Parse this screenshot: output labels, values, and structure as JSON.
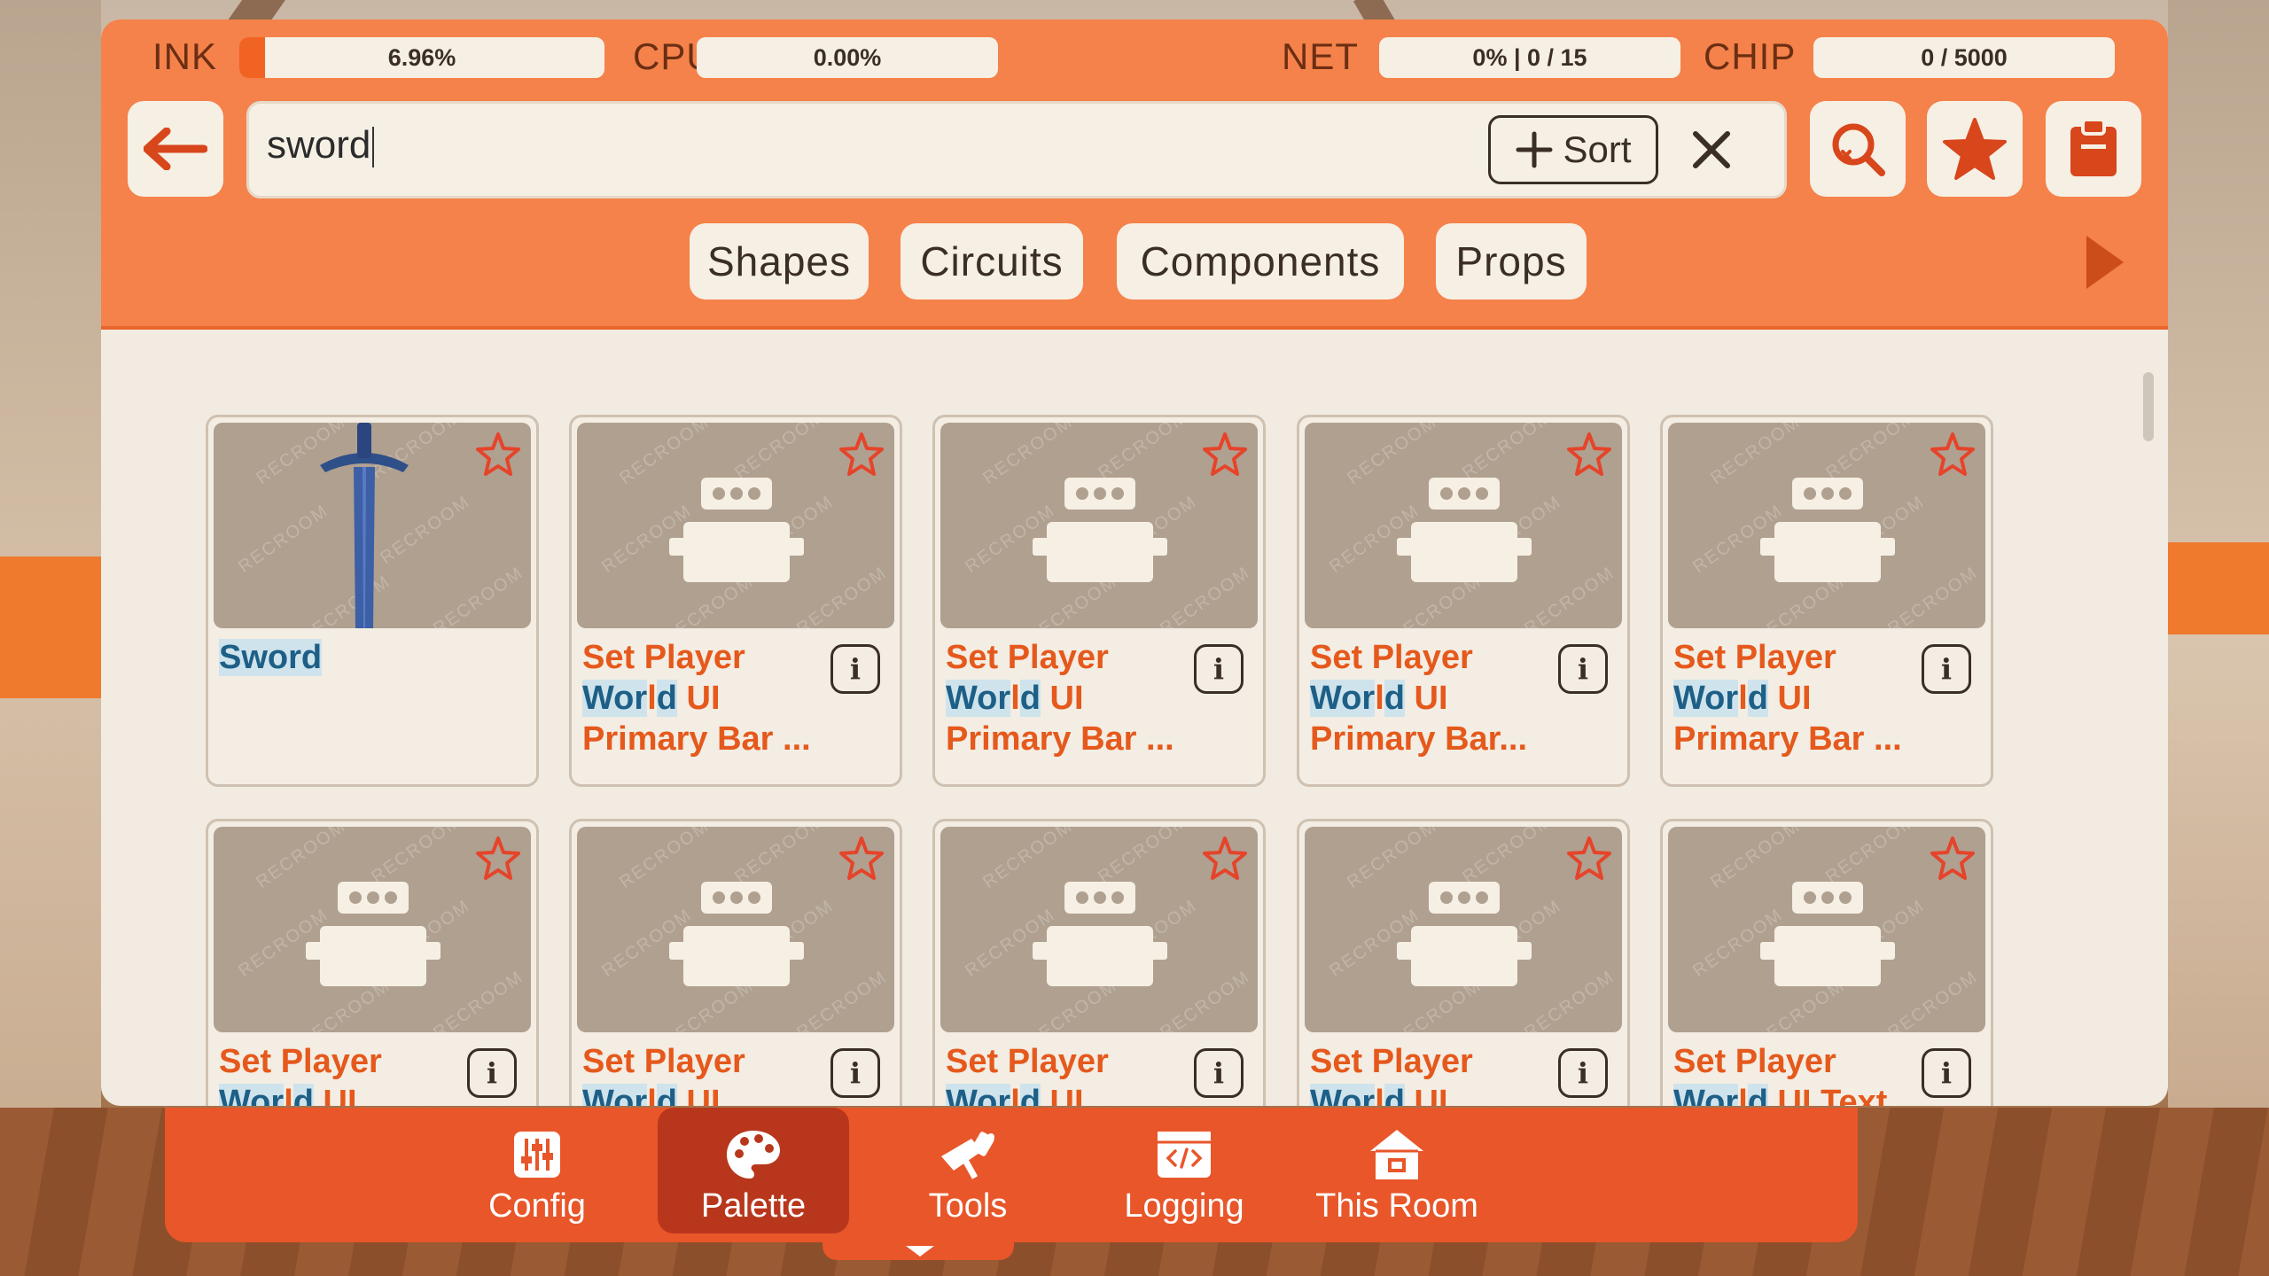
{
  "stats": {
    "ink": {
      "label": "INK",
      "value": "6.96%",
      "fill": 0.0696
    },
    "cpu": {
      "label": "CPU",
      "value": "0.00%"
    },
    "net": {
      "label": "NET",
      "value": "0% | 0 / 15"
    },
    "chip": {
      "label": "CHIP",
      "value": "0 / 5000"
    }
  },
  "toolbar": {
    "back_icon": "arrow-left-icon",
    "search_value": "sword",
    "sort_label": "Sort",
    "clear_icon": "close-icon",
    "search_filter_icon": "search-clear-icon",
    "favorites_icon": "star-icon",
    "clipboard_icon": "clipboard-icon"
  },
  "categories": [
    "Shapes",
    "Circuits",
    "Components",
    "Props"
  ],
  "watermark": "RECROOM",
  "cards": [
    {
      "title_parts": [
        [
          "Sword",
          "hl"
        ]
      ],
      "type": "prop",
      "info": false
    },
    {
      "title_parts": [
        [
          "Set Player ",
          ""
        ],
        [
          "Wor",
          "hl"
        ],
        [
          "l",
          ""
        ],
        [
          "d",
          "hl"
        ],
        [
          " UI Primary Bar ...",
          ""
        ]
      ],
      "type": "chip",
      "info": true
    },
    {
      "title_parts": [
        [
          "Set Player ",
          ""
        ],
        [
          "Wor",
          "hl"
        ],
        [
          "l",
          ""
        ],
        [
          "d",
          "hl"
        ],
        [
          " UI Primary Bar ...",
          ""
        ]
      ],
      "type": "chip",
      "info": true
    },
    {
      "title_parts": [
        [
          "Set Player ",
          ""
        ],
        [
          "Wor",
          "hl"
        ],
        [
          "l",
          ""
        ],
        [
          "d",
          "hl"
        ],
        [
          " UI Primary Bar...",
          ""
        ]
      ],
      "type": "chip",
      "info": true
    },
    {
      "title_parts": [
        [
          "Set Player ",
          ""
        ],
        [
          "Wor",
          "hl"
        ],
        [
          "l",
          ""
        ],
        [
          "d",
          "hl"
        ],
        [
          " UI Primary Bar ...",
          ""
        ]
      ],
      "type": "chip",
      "info": true
    },
    {
      "title_parts": [
        [
          "Set Player ",
          ""
        ],
        [
          "Wor",
          "hl"
        ],
        [
          "l",
          ""
        ],
        [
          "d",
          "hl"
        ],
        [
          " UI",
          ""
        ]
      ],
      "type": "chip",
      "info": true
    },
    {
      "title_parts": [
        [
          "Set Player ",
          ""
        ],
        [
          "Wor",
          "hl"
        ],
        [
          "l",
          ""
        ],
        [
          "d",
          "hl"
        ],
        [
          " UI",
          ""
        ]
      ],
      "type": "chip",
      "info": true
    },
    {
      "title_parts": [
        [
          "Set Player ",
          ""
        ],
        [
          "Wor",
          "hl"
        ],
        [
          "l",
          ""
        ],
        [
          "d",
          "hl"
        ],
        [
          " UI",
          ""
        ]
      ],
      "type": "chip",
      "info": true
    },
    {
      "title_parts": [
        [
          "Set Player ",
          ""
        ],
        [
          "Wor",
          "hl"
        ],
        [
          "l",
          ""
        ],
        [
          "d",
          "hl"
        ],
        [
          " UI",
          ""
        ]
      ],
      "type": "chip",
      "info": true
    },
    {
      "title_parts": [
        [
          "Set Player ",
          ""
        ],
        [
          "Wor",
          "hl"
        ],
        [
          "l",
          ""
        ],
        [
          "d",
          "hl"
        ],
        [
          " UI Text",
          ""
        ]
      ],
      "type": "chip",
      "info": true
    }
  ],
  "nav": [
    {
      "label": "Config",
      "icon": "sliders-icon",
      "active": false
    },
    {
      "label": "Palette",
      "icon": "palette-icon",
      "active": true
    },
    {
      "label": "Tools",
      "icon": "maker-pen-icon",
      "active": false
    },
    {
      "label": "Logging",
      "icon": "code-window-icon",
      "active": false
    },
    {
      "label": "This Room",
      "icon": "house-icon",
      "active": false
    }
  ],
  "colors": {
    "accent": "#f4824a",
    "nav": "#e8562a",
    "nav_active": "#b8371c",
    "title": "#e5591c",
    "highlight": "#1d5f86"
  }
}
